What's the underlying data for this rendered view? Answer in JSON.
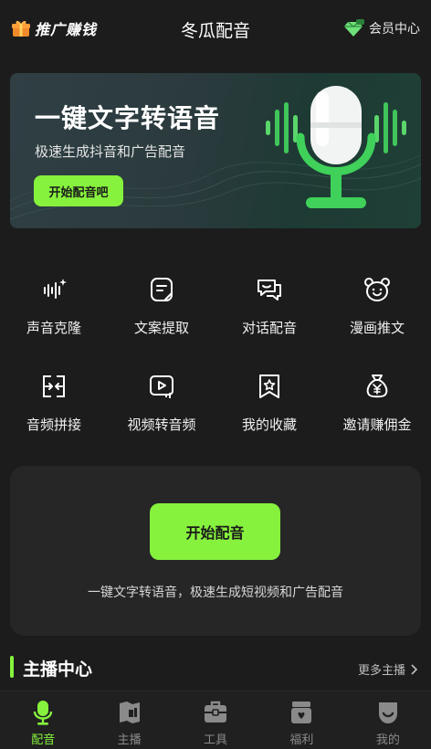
{
  "header": {
    "promo_label": "推广赚钱",
    "title": "冬瓜配音",
    "member_label": "会员中心"
  },
  "banner": {
    "title": "一键文字转语音",
    "subtitle": "极速生成抖音和广告配音",
    "button_label": "开始配音吧"
  },
  "features": [
    {
      "label": "声音克隆",
      "icon": "voice-clone-icon"
    },
    {
      "label": "文案提取",
      "icon": "text-extract-icon"
    },
    {
      "label": "对话配音",
      "icon": "dialogue-icon"
    },
    {
      "label": "漫画推文",
      "icon": "bear-icon"
    },
    {
      "label": "音频拼接",
      "icon": "audio-merge-icon"
    },
    {
      "label": "视频转音频",
      "icon": "video-to-audio-icon"
    },
    {
      "label": "我的收藏",
      "icon": "bookmark-star-icon"
    },
    {
      "label": "邀请赚佣金",
      "icon": "money-bag-icon"
    }
  ],
  "start_card": {
    "button_label": "开始配音",
    "description": "一键文字转语音，极速生成短视频和广告配音"
  },
  "section": {
    "title": "主播中心",
    "more_label": "更多主播"
  },
  "bottom_nav": [
    {
      "label": "配音",
      "icon": "microphone-icon",
      "active": true
    },
    {
      "label": "主播",
      "icon": "anchor-icon",
      "active": false
    },
    {
      "label": "工具",
      "icon": "toolbox-icon",
      "active": false
    },
    {
      "label": "福利",
      "icon": "gift-box-icon",
      "active": false
    },
    {
      "label": "我的",
      "icon": "profile-icon",
      "active": false
    }
  ],
  "colors": {
    "accent": "#86f23d",
    "background": "#1c1c1c",
    "card": "#262626"
  }
}
